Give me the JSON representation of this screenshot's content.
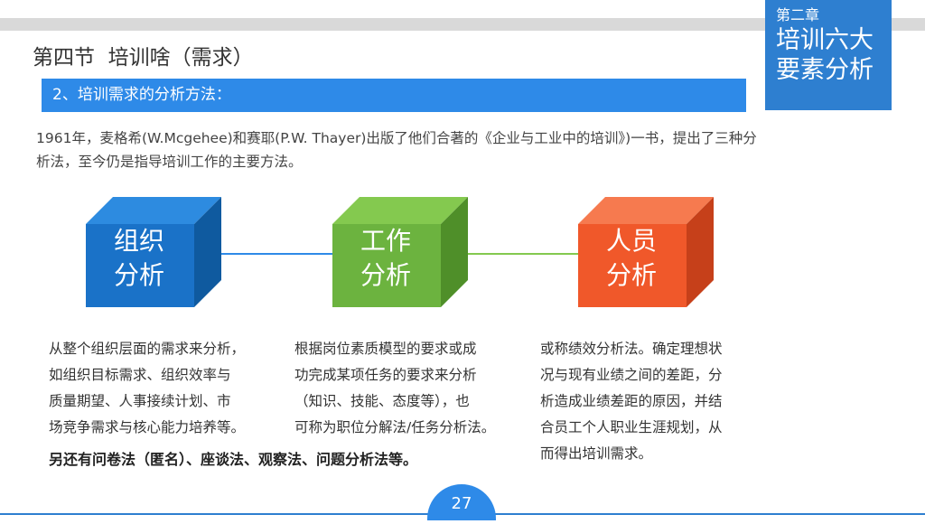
{
  "chapter": {
    "small": "第二章",
    "big_line1": "培训六大",
    "big_line2": "要素分析"
  },
  "page_title": "第四节  培训啥（需求）",
  "subtitle": "2、培训需求的分析方法：",
  "intro": "1961年，麦格希(W.Mcgehee)和赛耶(P.W. Thayer)出版了他们合著的《企业与工业中的培训》)一书，提出了三种分析法，至今仍是指导培训工作的主要方法。",
  "cubes": [
    {
      "label": "组织\n分析",
      "front": "#1a72c8",
      "top": "#2d8be0",
      "side": "#0f5a9f",
      "desc": [
        "从整个组织层面的需求来分析，",
        "如组织目标需求、组织效率与",
        "质量期望、人事接续计划、市",
        "场竞争需求与核心能力培养等。"
      ]
    },
    {
      "label": "工作\n分析",
      "front": "#6cb33f",
      "top": "#84c94f",
      "side": "#4f8f29",
      "desc": [
        "根据岗位素质模型的要求或成",
        "功完成某项任务的要求来分析",
        "（知识、技能、态度等），也",
        "可称为职位分解法/任务分析法。"
      ]
    },
    {
      "label": "人员\n分析",
      "front": "#f0582a",
      "top": "#f67a4f",
      "side": "#c6401a",
      "desc": [
        "或称绩效分析法。确定理想状",
        "况与现有业绩之间的差距，分",
        "析造成业绩差距的原因，并结",
        "合员工个人职业生涯规划，从",
        "而得出培训需求。"
      ]
    }
  ],
  "colors": {
    "blue_line": "#2e8ae8",
    "green_line": "#84c94f"
  },
  "note": "另还有问卷法（匿名）、座谈法、观察法、问题分析法等。",
  "page_number": "27"
}
